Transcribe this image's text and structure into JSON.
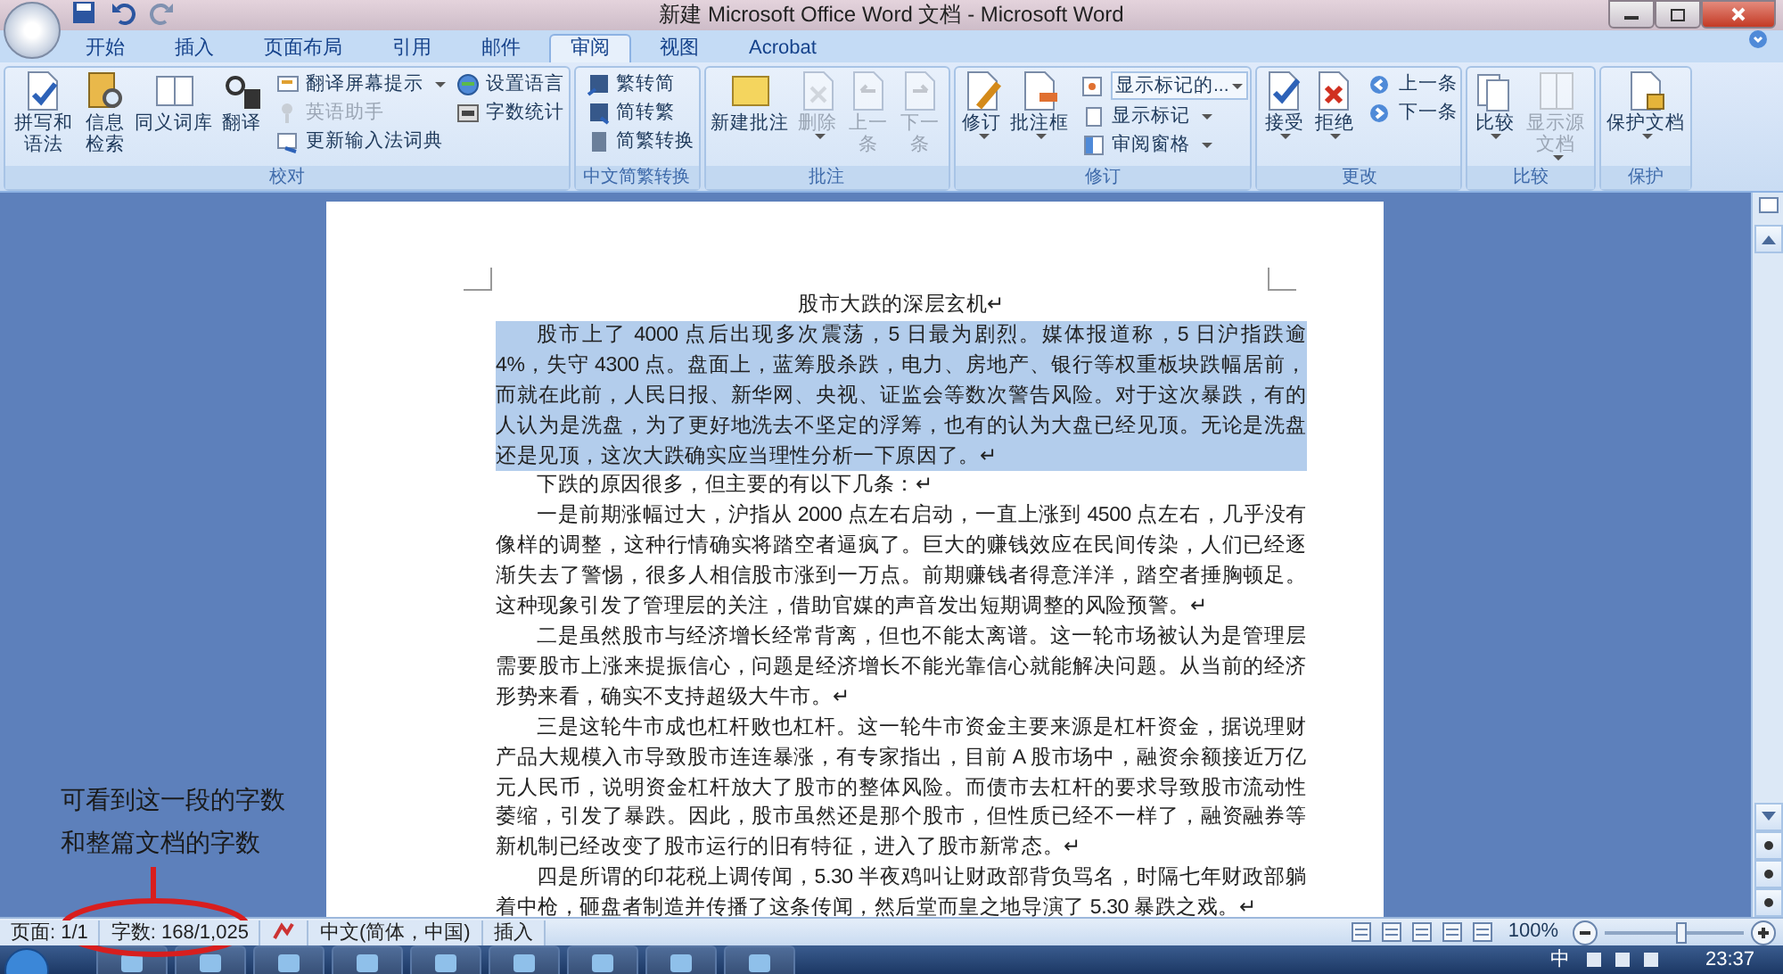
{
  "window": {
    "title": "新建 Microsoft Office Word 文档 - Microsoft Word"
  },
  "tabs": [
    {
      "label": "开始",
      "selected": false
    },
    {
      "label": "插入",
      "selected": false
    },
    {
      "label": "页面布局",
      "selected": false
    },
    {
      "label": "引用",
      "selected": false
    },
    {
      "label": "邮件",
      "selected": false
    },
    {
      "label": "审阅",
      "selected": true
    },
    {
      "label": "视图",
      "selected": false
    },
    {
      "label": "Acrobat",
      "selected": false
    }
  ],
  "ribbon": {
    "groups": [
      {
        "label": "校对",
        "items": [
          {
            "kind": "tall",
            "label": "拼写和语法"
          },
          {
            "kind": "tall",
            "label": "信息检索"
          },
          {
            "kind": "large",
            "label": "同义词库"
          },
          {
            "kind": "large",
            "label": "翻译"
          },
          {
            "kind": "small",
            "label": "翻译屏幕提示",
            "dropdown": true
          },
          {
            "kind": "small",
            "label": "英语助手",
            "disabled": true
          },
          {
            "kind": "small",
            "label": "更新输入法词典"
          },
          {
            "kind": "small",
            "label": "设置语言"
          },
          {
            "kind": "small",
            "label": "字数统计"
          }
        ]
      },
      {
        "label": "中文简繁转换",
        "items": [
          {
            "kind": "small",
            "label": "繁转简"
          },
          {
            "kind": "small",
            "label": "简转繁"
          },
          {
            "kind": "small",
            "label": "简繁转换"
          }
        ]
      },
      {
        "label": "批注",
        "items": [
          {
            "kind": "large",
            "label": "新建批注"
          },
          {
            "kind": "large",
            "label": "删除",
            "dropdown": true,
            "disabled": true
          },
          {
            "kind": "tall",
            "label": "上一条",
            "disabled": true
          },
          {
            "kind": "tall",
            "label": "下一条",
            "disabled": true
          }
        ]
      },
      {
        "label": "修订",
        "items": [
          {
            "kind": "large",
            "label": "修订",
            "dropdown": true
          },
          {
            "kind": "large",
            "label": "批注框",
            "dropdown": true
          },
          {
            "kind": "select",
            "value": "显示标记的..."
          },
          {
            "kind": "small",
            "label": "显示标记",
            "dropdown": true
          },
          {
            "kind": "small",
            "label": "审阅窗格",
            "dropdown": true
          }
        ]
      },
      {
        "label": "更改",
        "items": [
          {
            "kind": "large",
            "label": "接受",
            "dropdown": true
          },
          {
            "kind": "large",
            "label": "拒绝",
            "dropdown": true
          },
          {
            "kind": "small",
            "label": "上一条"
          },
          {
            "kind": "small",
            "label": "下一条"
          }
        ]
      },
      {
        "label": "比较",
        "items": [
          {
            "kind": "large",
            "label": "比较",
            "dropdown": true
          },
          {
            "kind": "tall",
            "label": "显示源文档",
            "dropdown": true,
            "disabled": true
          }
        ]
      },
      {
        "label": "保护",
        "items": [
          {
            "kind": "large",
            "label": "保护文档",
            "dropdown": true
          }
        ]
      }
    ]
  },
  "document": {
    "title": "股市大跌的深层玄机↵",
    "paragraphs": [
      {
        "text": "股市上了 4000 点后出现多次震荡，5 日最为剧烈。媒体报道称，5 日沪指跌逾 4%，失守 4300 点。盘面上，蓝筹股杀跌，电力、房地产、银行等权重板块跌幅居前，而就在此前，人民日报、新华网、央视、证监会等数次警告风险。对于这次暴跌，有的人认为是洗盘，为了更好地洗去不坚定的浮筹，也有的认为大盘已经见顶。无论是洗盘还是见顶，这次大跌确实应当理性分析一下原因了。↵",
        "selected": true
      },
      {
        "text": "下跌的原因很多，但主要的有以下几条：↵",
        "selected": false
      },
      {
        "text": "一是前期涨幅过大，沪指从 2000 点左右启动，一直上涨到 4500 点左右，几乎没有像样的调整，这种行情确实将踏空者逼疯了。巨大的赚钱效应在民间传染，人们已经逐渐失去了警惕，很多人相信股市涨到一万点。前期赚钱者得意洋洋，踏空者捶胸顿足。这种现象引发了管理层的关注，借助官媒的声音发出短期调整的风险预警。↵",
        "selected": false
      },
      {
        "text": "二是虽然股市与经济增长经常背离，但也不能太离谱。这一轮市场被认为是管理层需要股市上涨来提振信心，问题是经济增长不能光靠信心就能解决问题。从当前的经济形势来看，确实不支持超级大牛市。↵",
        "selected": false
      },
      {
        "text": "三是这轮牛市成也杠杆败也杠杆。这一轮牛市资金主要来源是杠杆资金，据说理财产品大规模入市导致股市连连暴涨，有专家指出，目前 A 股市场中，融资余额接近万亿元人民币，说明资金杠杆放大了股市的整体风险。而债市去杠杆的要求导致股市流动性萎缩，引发了暴跌。因此，股市虽然还是那个股市，但性质已经不一样了，融资融券等新机制已经改变了股市运行的旧有特征，进入了股市新常态。↵",
        "selected": false
      },
      {
        "text": "四是所谓的印花税上调传闻，5.30 半夜鸡叫让财政部背负骂名，时隔七年财政部躺着中枪，砸盘者制造并传播了这条传闻，然后堂而皇之地导演了 5.30 暴跌之戏。↵",
        "selected": false
      }
    ]
  },
  "annotation": {
    "lines": [
      "可看到这一段的字数",
      "和整篇文档的字数"
    ]
  },
  "status_bar": {
    "page": "页面: 1/1",
    "words": "字数: 168/1,025",
    "language": "中文(简体，中国)",
    "mode": "插入",
    "zoom": "100%",
    "zoom_level": {
      "level": 0.55
    }
  },
  "taskbar": {
    "ime": "中",
    "clock": "23:37"
  }
}
